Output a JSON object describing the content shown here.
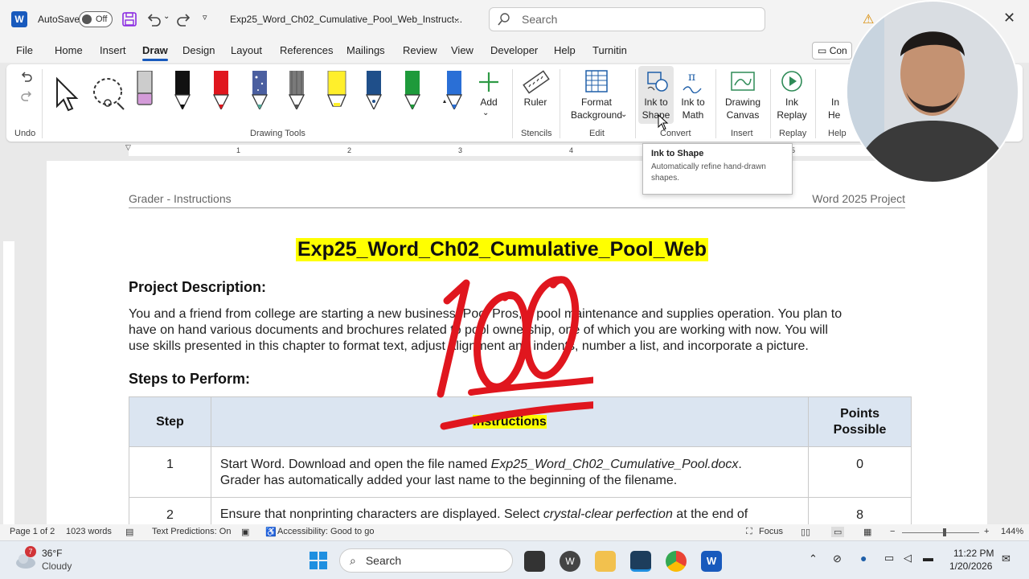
{
  "titlebar": {
    "autosave_label": "AutoSave",
    "autosave_state": "Off",
    "filename": "Exp25_Word_Ch02_Cumulative_Pool_Web_Instruct...",
    "search_placeholder": "Search"
  },
  "menu": [
    "File",
    "Home",
    "Insert",
    "Draw",
    "Design",
    "Layout",
    "References",
    "Mailings",
    "Review",
    "View",
    "Developer",
    "Help",
    "Turnitin"
  ],
  "menu_active": "Draw",
  "comments_partial": "Con",
  "ribbon": {
    "undo_group": "Undo",
    "drawing_tools_group": "Drawing Tools",
    "add_label": "Add",
    "ruler_label": "Ruler",
    "stencils_group": "Stencils",
    "format_bg_line1": "Format",
    "format_bg_line2": "Background",
    "edit_group": "Edit",
    "ink_to_shape_1": "Ink to",
    "ink_to_shape_2": "Shape",
    "ink_to_math_1": "Ink to",
    "ink_to_math_2": "Math",
    "convert_group": "Convert",
    "drawing_canvas_1": "Drawing",
    "drawing_canvas_2": "Canvas",
    "insert_group": "Insert",
    "ink_replay_1": "Ink",
    "ink_replay_2": "Replay",
    "replay_group": "Replay",
    "ink_help_1": "In",
    "ink_help_2": "He",
    "help_group": "Help"
  },
  "tooltip": {
    "title": "Ink to Shape",
    "body": "Automatically refine hand-drawn shapes."
  },
  "ruler_numbers": [
    "1",
    "2",
    "3",
    "4",
    "5"
  ],
  "document": {
    "header_left": "Grader - Instructions",
    "header_right": "Word 2025 Project",
    "title": "Exp25_Word_Ch02_Cumulative_Pool_Web",
    "project_desc_heading": "Project Description:",
    "project_desc_line1": "You and a friend from college are starting a new business, Pool Pros, a pool maintenance and supplies operation. You plan to",
    "project_desc_line2": "have on hand various documents and brochures related to pool ownership, one of which you are working with now. You will",
    "project_desc_line3": "use skills presented in this chapter to format text, adjust alignment and indents, number a list, and incorporate a picture.",
    "steps_heading": "Steps to Perform:",
    "ink_annotation": "100",
    "table": {
      "col_step": "Step",
      "col_instructions": "Instructions",
      "col_points_1": "Points",
      "col_points_2": "Possible",
      "rows": [
        {
          "step": "1",
          "text_a": "Start Word. Download and open the file named ",
          "text_b": "Exp25_Word_Ch02_Cumulative_Pool.docx",
          "text_c": ".",
          "text_line2": "Grader has automatically added your last name to the beginning of the filename.",
          "points": "0"
        },
        {
          "step": "2",
          "text_a": "Ensure that nonprinting characters are displayed. Select ",
          "text_b": "crystal-clear perfection",
          "text_c": " at the end of",
          "points": "8"
        }
      ]
    }
  },
  "statusbar": {
    "page": "Page 1 of 2",
    "words": "1023 words",
    "text_predictions": "Text Predictions: On",
    "accessibility": "Accessibility: Good to go",
    "focus": "Focus",
    "zoom": "144%"
  },
  "taskbar": {
    "weather_temp": "36°F",
    "weather_desc": "Cloudy",
    "weather_badge": "7",
    "search": "Search",
    "time": "11:22 PM",
    "date": "1/20/2026"
  },
  "colors": {
    "accent": "#185abd",
    "highlight": "#ffff00",
    "ink_red": "#e0161e",
    "table_header": "#dbe5f1"
  }
}
